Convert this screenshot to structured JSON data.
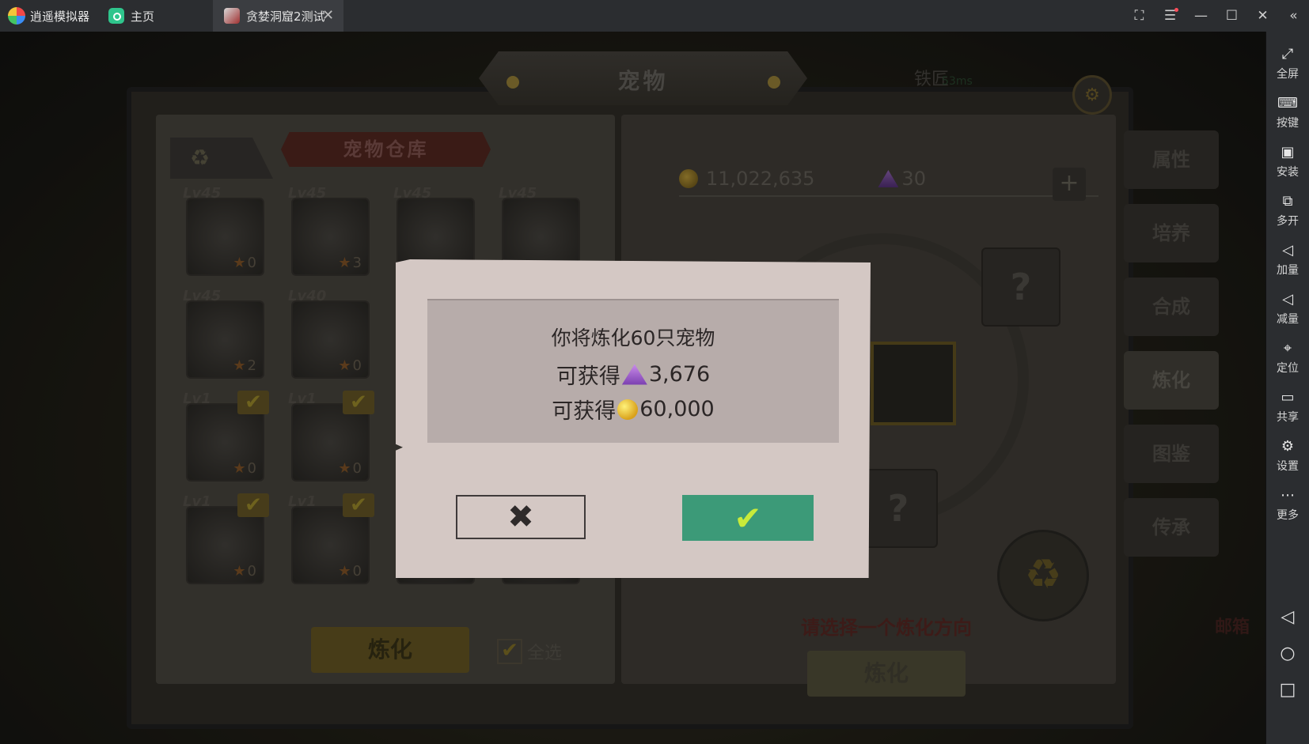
{
  "titlebar": {
    "app_name": "逍遥模拟器",
    "tabs": [
      {
        "label": "主页"
      },
      {
        "label": "贪婪洞窟2测试"
      }
    ],
    "controls": [
      "screenshot-icon",
      "menu-icon",
      "minimize-icon",
      "maximize-icon",
      "close-icon",
      "collapse-icon"
    ]
  },
  "sidebar": {
    "items": [
      {
        "label": "全屏",
        "icon": "fullscreen-icon",
        "glyph": "⤢"
      },
      {
        "label": "按键",
        "icon": "keyboard-icon",
        "glyph": "⌨"
      },
      {
        "label": "安装",
        "icon": "apk-install-icon",
        "glyph": "▣"
      },
      {
        "label": "多开",
        "icon": "multi-instance-icon",
        "glyph": "⧉"
      },
      {
        "label": "加量",
        "icon": "volume-up-icon",
        "glyph": "◁"
      },
      {
        "label": "减量",
        "icon": "volume-down-icon",
        "glyph": "◁"
      },
      {
        "label": "定位",
        "icon": "location-icon",
        "glyph": "⌖"
      },
      {
        "label": "共享",
        "icon": "folder-icon",
        "glyph": "▭"
      },
      {
        "label": "设置",
        "icon": "gear-icon",
        "glyph": "⚙"
      },
      {
        "label": "更多",
        "icon": "more-icon",
        "glyph": "⋯"
      }
    ],
    "nav": [
      "back-icon",
      "home-icon",
      "recent-apps-icon"
    ]
  },
  "game": {
    "header_title": "宠物",
    "top_label": "铁匠",
    "ping": "53ms",
    "warehouse_title": "宠物仓库",
    "pets": [
      {
        "lv": "Lv45",
        "stars": "0",
        "checked": false
      },
      {
        "lv": "Lv45",
        "stars": "3",
        "checked": false
      },
      {
        "lv": "Lv45",
        "stars": "",
        "checked": false
      },
      {
        "lv": "Lv45",
        "stars": "",
        "checked": false
      },
      {
        "lv": "Lv45",
        "stars": "2",
        "checked": false
      },
      {
        "lv": "Lv40",
        "stars": "0",
        "checked": false
      },
      {
        "lv": "Lv1",
        "stars": "0",
        "checked": true
      },
      {
        "lv": "Lv1",
        "stars": "0",
        "checked": true
      },
      {
        "lv": "Lv1",
        "stars": "0",
        "checked": true
      },
      {
        "lv": "Lv1",
        "stars": "0",
        "checked": true
      },
      {
        "lv": "",
        "stars": "0",
        "checked": false
      },
      {
        "lv": "",
        "stars": "0",
        "checked": false
      }
    ],
    "refine_button_left": "炼化",
    "select_all": "全选",
    "gold": "11,022,635",
    "gems": "30",
    "hint": "请选择一个炼化方向",
    "refine_button_right": "炼化",
    "side_tabs": [
      "属性",
      "培养",
      "合成",
      "炼化",
      "图鉴",
      "传承"
    ],
    "side_tab_selected": 3,
    "mailbox": "邮箱"
  },
  "dialog": {
    "title": "你将炼化60只宠物",
    "gain_prefix": "可获得",
    "gem_amount": "3,676",
    "coin_amount": "60,000",
    "cancel_symbol": "✖",
    "confirm_symbol": "✔",
    "confirm_color": "#3c9a78"
  }
}
